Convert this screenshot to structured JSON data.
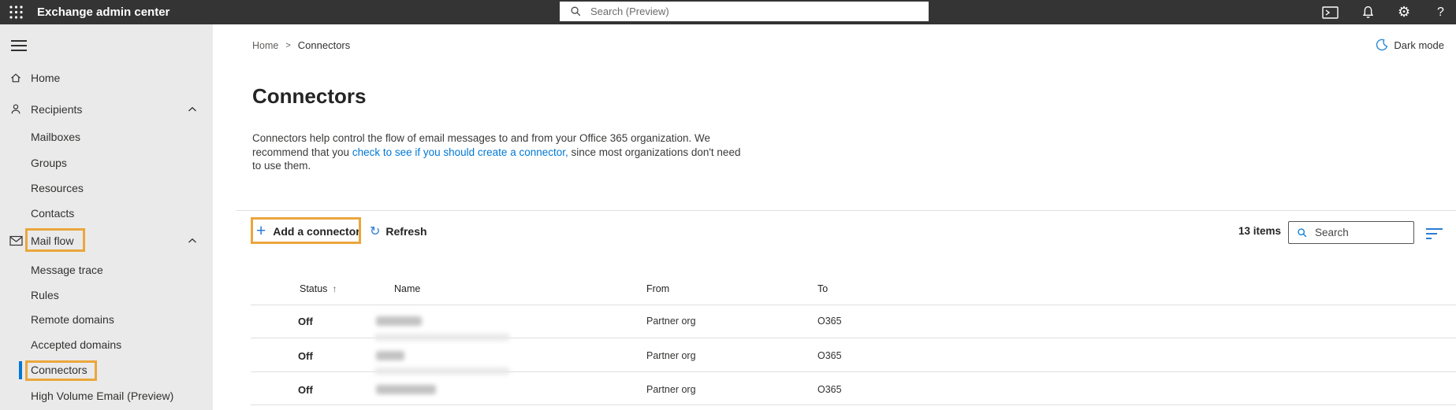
{
  "topbar": {
    "title": "Exchange admin center",
    "search_placeholder": "Search (Preview)"
  },
  "sidebar": {
    "items": [
      {
        "label": "Home",
        "icon": "home-icon",
        "level": "top"
      },
      {
        "label": "Recipients",
        "icon": "person-icon",
        "level": "top",
        "expanded": true
      },
      {
        "label": "Mailboxes",
        "level": "sub"
      },
      {
        "label": "Groups",
        "level": "sub"
      },
      {
        "label": "Resources",
        "level": "sub"
      },
      {
        "label": "Contacts",
        "level": "sub"
      },
      {
        "label": "Mail flow",
        "icon": "envelope-icon",
        "level": "top",
        "expanded": true,
        "annotated": true
      },
      {
        "label": "Message trace",
        "level": "sub"
      },
      {
        "label": "Rules",
        "level": "sub"
      },
      {
        "label": "Remote domains",
        "level": "sub"
      },
      {
        "label": "Accepted domains",
        "level": "sub"
      },
      {
        "label": "Connectors",
        "level": "sub",
        "selected": true,
        "annotated": true
      },
      {
        "label": "High Volume Email (Preview)",
        "level": "sub"
      }
    ]
  },
  "main": {
    "breadcrumb": [
      "Home",
      "Connectors"
    ],
    "dark_mode_label": "Dark mode",
    "title": "Connectors",
    "description": {
      "before": "Connectors help control the flow of email messages to and from your Office 365 organization. We recommend that you ",
      "link": "check to see if you should create a connector,",
      "after": " since most organizations don't need to use them."
    },
    "toolbar": {
      "add_label": "Add a connector",
      "refresh_label": "Refresh",
      "items_count": "13 items",
      "search_placeholder": "Search"
    },
    "table": {
      "columns": [
        "Status",
        "Name",
        "From",
        "To"
      ],
      "sort": {
        "column": "Status",
        "direction": "ascending"
      },
      "rows": [
        {
          "status": "Off",
          "name_redacted": true,
          "from": "Partner org",
          "to": "O365"
        },
        {
          "status": "Off",
          "name_redacted": true,
          "from": "Partner org",
          "to": "O365"
        },
        {
          "status": "Off",
          "name_redacted": true,
          "from": "Partner org",
          "to": "O365"
        }
      ]
    }
  },
  "icons": {
    "add": "+",
    "refresh": "↻",
    "sort_ascending": "↑",
    "breadcrumb_separator": ">",
    "settings_gear": "⚙",
    "help": "?"
  },
  "colors": {
    "topbar_bg": "#343434",
    "sidebar_bg": "#eaeaea",
    "accent_blue": "#0078d4",
    "toolbar_icon_blue": "#2b7cd3",
    "annotation_orange": "#eaa63c",
    "selected_indicator_blue": "#0078d4",
    "divider_gray": "#e1dfdd",
    "text_primary": "#242424",
    "text_secondary": "#605e5c",
    "moon_blue": "#2b88d8"
  }
}
